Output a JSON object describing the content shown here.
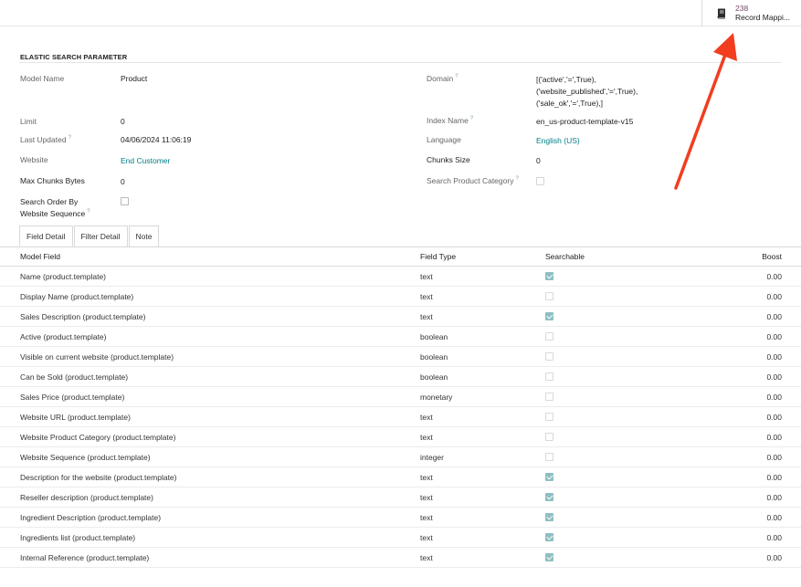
{
  "smart_button": {
    "count": "238",
    "label": "Record Mappi..."
  },
  "section": {
    "title": "ELASTIC SEARCH PARAMETER"
  },
  "form": {
    "model_name": {
      "label": "Model Name",
      "value": "Product"
    },
    "limit": {
      "label": "Limit",
      "value": "0"
    },
    "last_updated": {
      "label": "Last Updated",
      "value": "04/06/2024 11:06:19",
      "help": "?"
    },
    "website": {
      "label": "Website",
      "value": "End Customer"
    },
    "max_chunks_bytes": {
      "label": "Max Chunks Bytes",
      "value": "0"
    },
    "search_order": {
      "label_line1": "Search Order By",
      "label_line2": "Website Sequence",
      "help": "?",
      "checked": false
    },
    "domain": {
      "label": "Domain",
      "help": "?",
      "line1": "[('active','=',True),",
      "line2": "('website_published','=',True),",
      "line3": "('sale_ok','=',True),]"
    },
    "index_name": {
      "label": "Index Name",
      "help": "?",
      "value": "en_us-product-template-v15"
    },
    "language": {
      "label": "Language",
      "value": "English (US)"
    },
    "chunks_size": {
      "label": "Chunks Size",
      "value": "0"
    },
    "search_product_category": {
      "label": "Search Product Category",
      "help": "?",
      "checked": false
    }
  },
  "tabs": [
    {
      "label": "Field Detail",
      "active": true
    },
    {
      "label": "Filter Detail",
      "active": false
    },
    {
      "label": "Note",
      "active": false
    }
  ],
  "table": {
    "headers": {
      "model_field": "Model Field",
      "field_type": "Field Type",
      "searchable": "Searchable",
      "boost": "Boost"
    },
    "rows": [
      {
        "field": "Name (product.template)",
        "type": "text",
        "searchable": true,
        "boost": "0.00"
      },
      {
        "field": "Display Name (product.template)",
        "type": "text",
        "searchable": false,
        "boost": "0.00"
      },
      {
        "field": "Sales Description (product.template)",
        "type": "text",
        "searchable": true,
        "boost": "0.00"
      },
      {
        "field": "Active (product.template)",
        "type": "boolean",
        "searchable": false,
        "boost": "0.00"
      },
      {
        "field": "Visible on current website (product.template)",
        "type": "boolean",
        "searchable": false,
        "boost": "0.00"
      },
      {
        "field": "Can be Sold (product.template)",
        "type": "boolean",
        "searchable": false,
        "boost": "0.00"
      },
      {
        "field": "Sales Price (product.template)",
        "type": "monetary",
        "searchable": false,
        "boost": "0.00"
      },
      {
        "field": "Website URL (product.template)",
        "type": "text",
        "searchable": false,
        "boost": "0.00"
      },
      {
        "field": "Website Product Category (product.template)",
        "type": "text",
        "searchable": false,
        "boost": "0.00"
      },
      {
        "field": "Website Sequence (product.template)",
        "type": "integer",
        "searchable": false,
        "boost": "0.00"
      },
      {
        "field": "Description for the website (product.template)",
        "type": "text",
        "searchable": true,
        "boost": "0.00"
      },
      {
        "field": "Reseller description (product.template)",
        "type": "text",
        "searchable": true,
        "boost": "0.00"
      },
      {
        "field": "Ingredient Description (product.template)",
        "type": "text",
        "searchable": true,
        "boost": "0.00"
      },
      {
        "field": "Ingredients list (product.template)",
        "type": "text",
        "searchable": true,
        "boost": "0.00"
      },
      {
        "field": "Internal Reference (product.template)",
        "type": "text",
        "searchable": true,
        "boost": "0.00"
      }
    ]
  },
  "colors": {
    "brand": "#714b67",
    "link": "#017e84",
    "checkbox_on": "#8fbfc2",
    "annotation_arrow": "#f23d1f"
  }
}
